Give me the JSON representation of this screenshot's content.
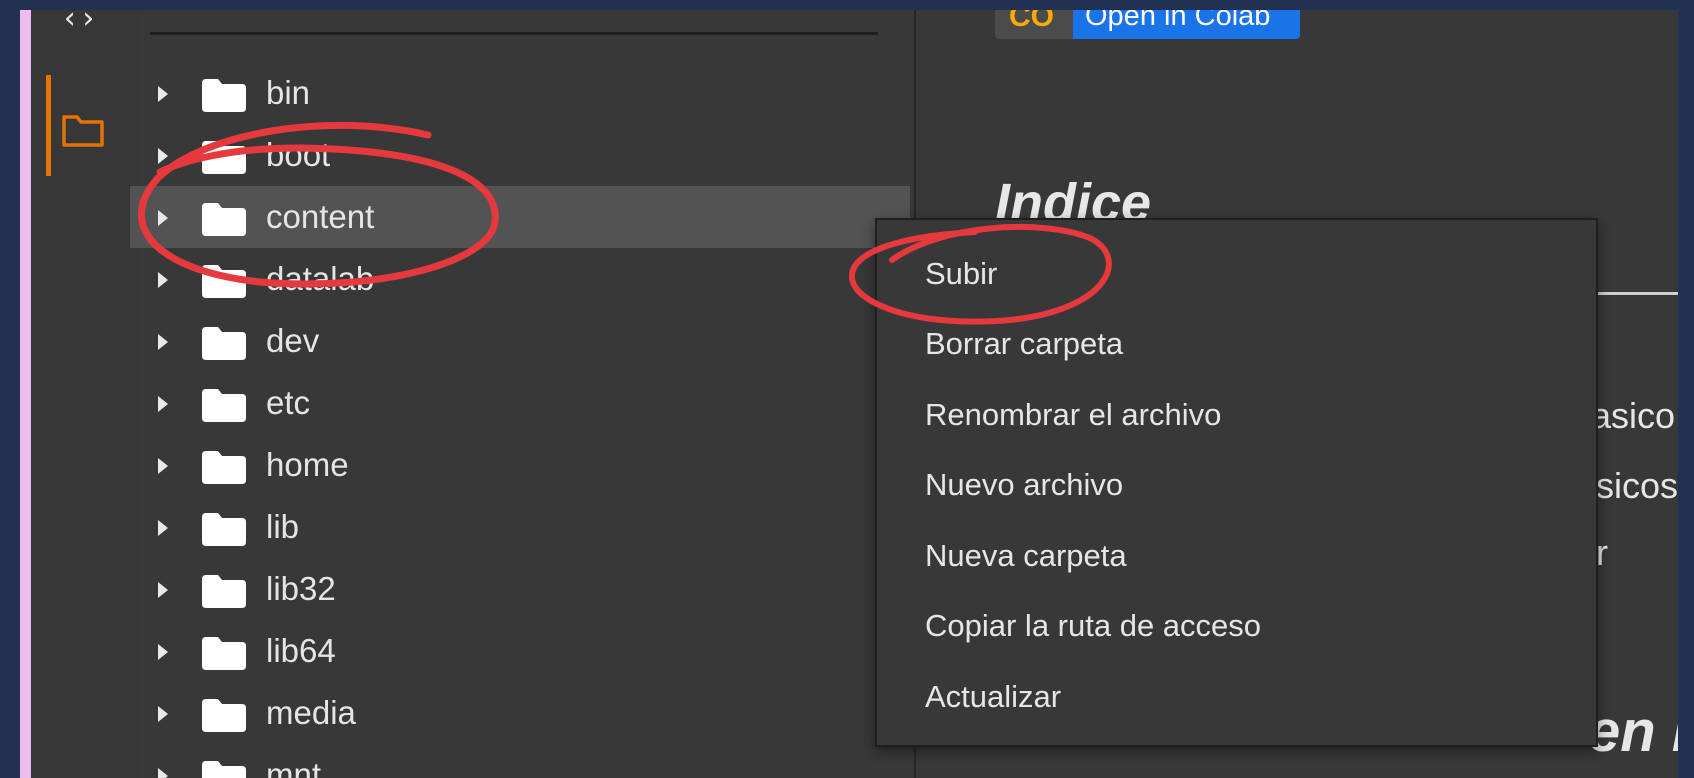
{
  "files": {
    "items": [
      {
        "label": "bin"
      },
      {
        "label": "boot"
      },
      {
        "label": "content"
      },
      {
        "label": "datalab"
      },
      {
        "label": "dev"
      },
      {
        "label": "etc"
      },
      {
        "label": "home"
      },
      {
        "label": "lib"
      },
      {
        "label": "lib32"
      },
      {
        "label": "lib64"
      },
      {
        "label": "media"
      },
      {
        "label": "mnt"
      }
    ],
    "selected": "content"
  },
  "notebook": {
    "badge_logo": "CO",
    "badge_label": "Open in Colab",
    "heading": "Indice",
    "frag1": "asico",
    "frag2": "sicos",
    "frag3": "r",
    "frag4": "en I"
  },
  "context_menu": {
    "items": [
      {
        "label": "Subir"
      },
      {
        "label": "Borrar carpeta"
      },
      {
        "label": "Renombrar el archivo"
      },
      {
        "label": "Nuevo archivo"
      },
      {
        "label": "Nueva carpeta"
      },
      {
        "label": "Copiar la ruta de acceso"
      },
      {
        "label": "Actualizar"
      }
    ]
  },
  "colors": {
    "accent_orange": "#e37400",
    "annotation_red": "#e5393d",
    "colab_blue": "#1a73e8"
  }
}
